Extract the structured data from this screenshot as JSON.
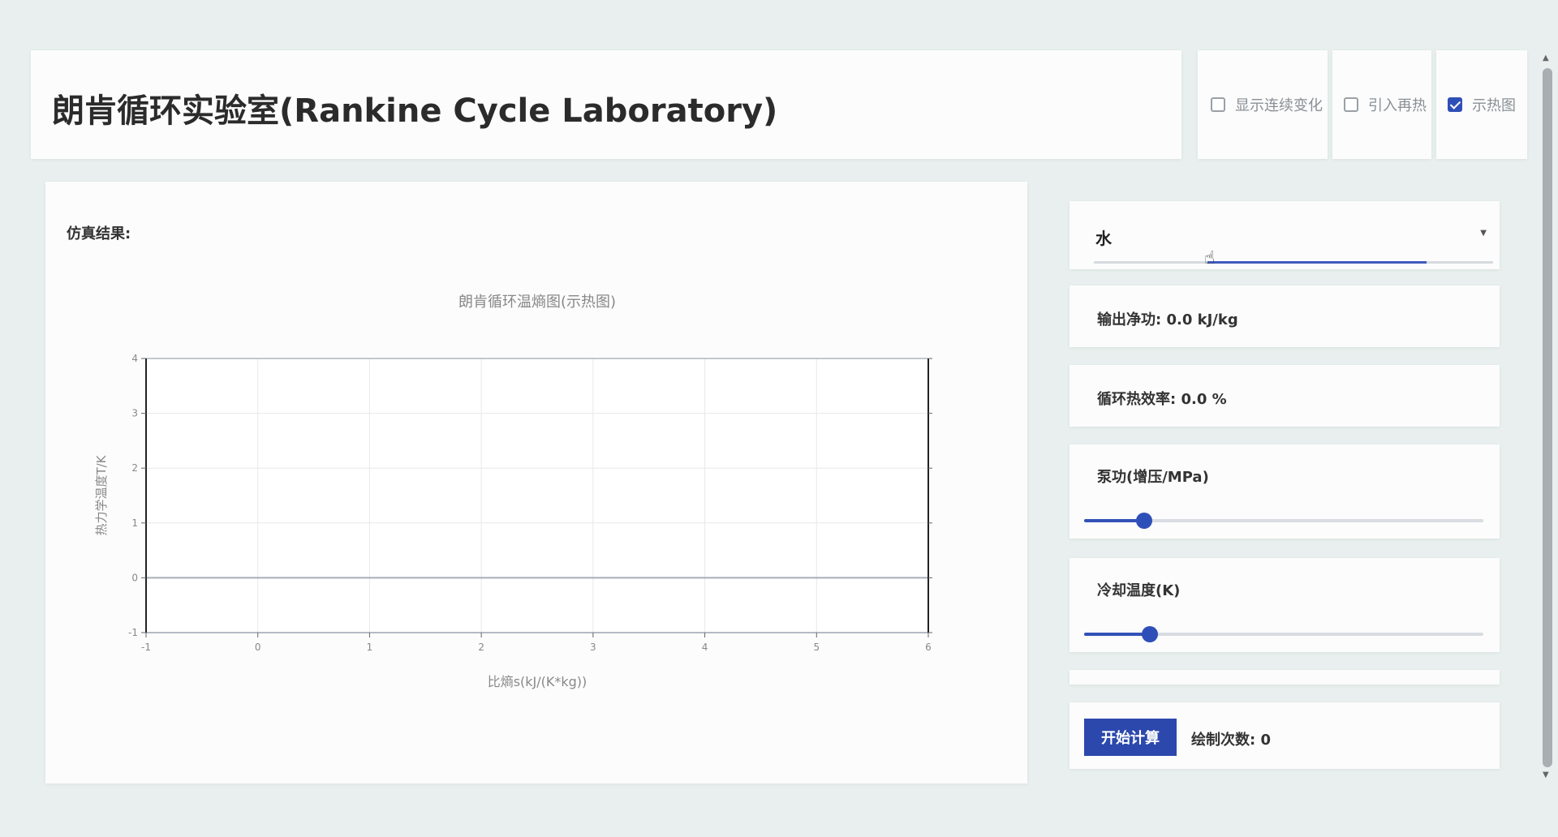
{
  "header": {
    "title": "朗肯循环实验室(Rankine Cycle Laboratory)"
  },
  "options": [
    {
      "label": "显示连续变化",
      "checked": false
    },
    {
      "label": "引入再热",
      "checked": false
    },
    {
      "label": "示热图",
      "checked": true
    }
  ],
  "results": {
    "label": "仿真结果:"
  },
  "chart_data": {
    "type": "line",
    "title": "朗肯循环温熵图(示热图)",
    "xlabel": "比熵s(kJ/(K*kg))",
    "ylabel": "热力学温度T/K",
    "xlim": [
      -1,
      6
    ],
    "ylim": [
      -1,
      4
    ],
    "x_ticks": [
      "-1",
      "0",
      "1",
      "2",
      "3",
      "4",
      "5",
      "6"
    ],
    "y_ticks": [
      "-1",
      "0",
      "1",
      "2",
      "3",
      "4"
    ],
    "grid": true,
    "series": []
  },
  "fluid": {
    "selected": "水"
  },
  "net_work": {
    "label": "输出净功:",
    "value": "0.0 kJ/kg"
  },
  "efficiency": {
    "label": "循环热效率:",
    "value": "0.0 %"
  },
  "pump": {
    "label": "泵功(增压/MPa)",
    "fraction": 0.15
  },
  "cooling": {
    "label": "冷却温度(K)",
    "fraction": 0.165
  },
  "actions": {
    "start_label": "开始计算",
    "draw_count_label": "绘制次数:",
    "draw_count_value": "0"
  },
  "colors": {
    "accent": "#2f4fb8",
    "background": "#e8efee",
    "card": "#fbfcfb"
  }
}
